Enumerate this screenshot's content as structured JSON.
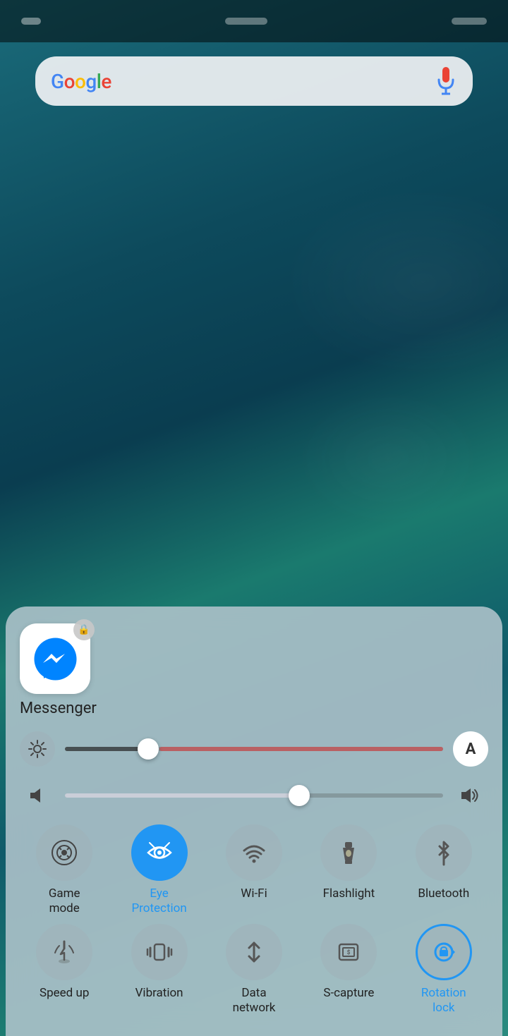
{
  "status_bar": {
    "left_blob": "status-left",
    "center_blob": "status-center",
    "right_blob": "status-right"
  },
  "search": {
    "logo": "Google",
    "mic_label": "microphone"
  },
  "panel": {
    "app": {
      "name": "Messenger",
      "lock_icon": "🔒"
    },
    "brightness": {
      "settings_icon": "⚙",
      "auto_label": "A",
      "thumb_percent": 22
    },
    "volume": {
      "mute_icon": "◄",
      "loud_icon": "🔊",
      "thumb_percent": 62
    },
    "toggles": [
      {
        "id": "game-mode",
        "icon": "🎮",
        "label": "Game\nmode",
        "active": false
      },
      {
        "id": "eye-protection",
        "icon": "👁",
        "label": "Eye\nProtection",
        "active": true
      },
      {
        "id": "wifi",
        "icon": "wifi",
        "label": "Wi-Fi",
        "active": false
      },
      {
        "id": "flashlight",
        "icon": "flashlight",
        "label": "Flashlight",
        "active": false
      },
      {
        "id": "bluetooth",
        "icon": "bluetooth",
        "label": "Bluetooth",
        "active": false
      },
      {
        "id": "speed-up",
        "icon": "rocket",
        "label": "Speed up",
        "active": false
      },
      {
        "id": "vibration",
        "icon": "vibration",
        "label": "Vibration",
        "active": false
      },
      {
        "id": "data-network",
        "icon": "data",
        "label": "Data\nnetwork",
        "active": false
      },
      {
        "id": "s-capture",
        "icon": "scapture",
        "label": "S-capture",
        "active": false
      },
      {
        "id": "rotation-lock",
        "icon": "rotation",
        "label": "Rotation\nlock",
        "active": true
      }
    ]
  }
}
